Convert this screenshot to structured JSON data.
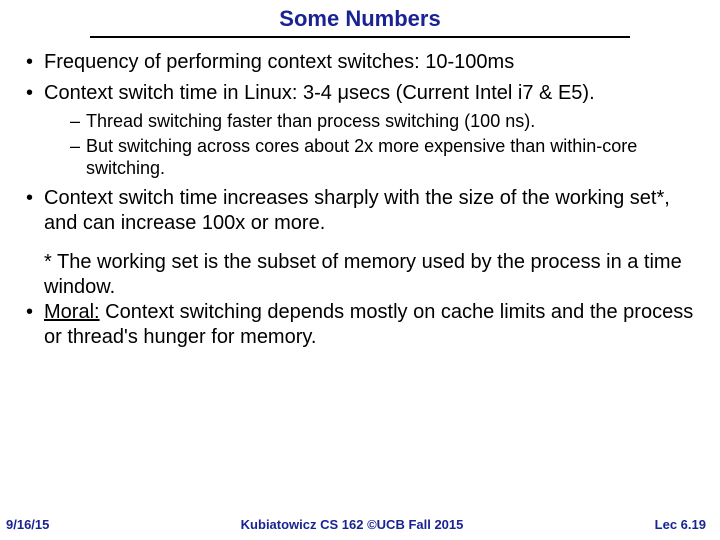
{
  "title": "Some Numbers",
  "bullets": {
    "b1": "Frequency of performing context switches: 10-100ms",
    "b2": "Context switch time in Linux: 3-4 μsecs (Current Intel i7 & E5).",
    "sub1": "Thread switching faster than process switching (100 ns).",
    "sub2": "But switching across cores about 2x more expensive than within-core switching.",
    "b3": "Context switch time increases sharply with the size of the working set*, and can increase 100x or more.",
    "note": "* The working set is the subset of memory used by the process in a time window.",
    "moral_label": "Moral:",
    "moral_text": " Context switching depends mostly on cache limits and the process or thread's hunger for memory."
  },
  "footer": {
    "left": "9/16/15",
    "center": "Kubiatowicz CS 162 ©UCB Fall 2015",
    "right": "Lec 6.19"
  }
}
